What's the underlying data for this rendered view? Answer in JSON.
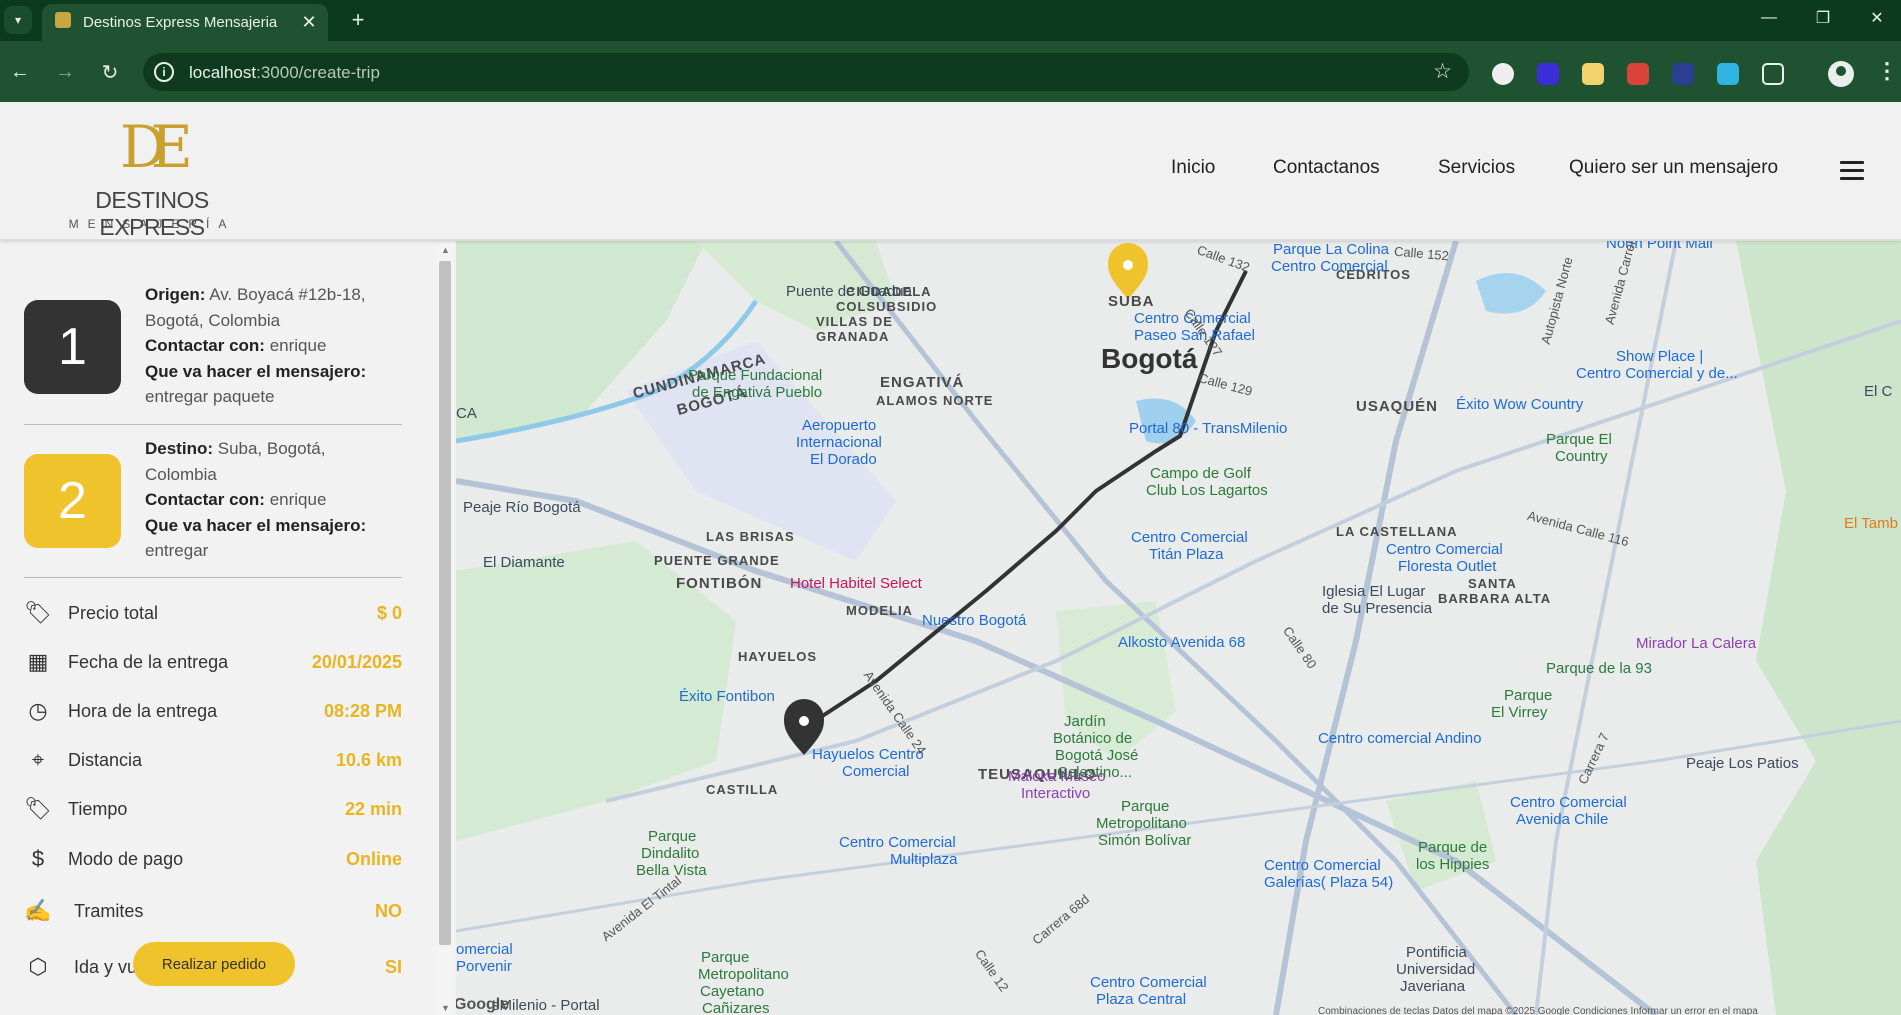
{
  "browser": {
    "tab_title": "Destinos Express Mensajeria",
    "url_host": "localhost",
    "url_path": ":3000/create-trip"
  },
  "header": {
    "logo_mono": "DE",
    "logo_name": "DESTINOS EXPRESS",
    "logo_sub": "MENSAJERÍA",
    "nav": [
      "Inicio",
      "Contactanos",
      "Servicios",
      "Quiero ser un mensajero"
    ]
  },
  "trip": {
    "origin": {
      "number": "1",
      "label": "Origen:",
      "address_line1": "Av. Boyacá #12b-18,",
      "address_line2": "Bogotá, Colombia",
      "contact_label": "Contactar con:",
      "contact": "enrique",
      "task_label": "Que va hacer el mensajero:",
      "task": "entregar paquete"
    },
    "destination": {
      "number": "2",
      "label": "Destino:",
      "address_line1": "Suba, Bogotá,",
      "address_line2": "Colombia",
      "contact_label": "Contactar con:",
      "contact": "enrique",
      "task_label": "Que va hacer el mensajero:",
      "task": "entregar"
    }
  },
  "summary": [
    {
      "label": "Precio total",
      "value": "$ 0",
      "icon": "price-tag-icon"
    },
    {
      "label": "Fecha de la entrega",
      "value": "20/01/2025",
      "icon": "calendar-icon"
    },
    {
      "label": "Hora de la entrega",
      "value": "08:28 PM",
      "icon": "clock-icon"
    },
    {
      "label": "Distancia",
      "value": "10.6 km",
      "icon": "location-pin-icon"
    },
    {
      "label": "Tiempo",
      "value": "22 min",
      "icon": "time-tag-icon"
    },
    {
      "label": "Modo de pago",
      "value": "Online",
      "icon": "dollar-icon"
    },
    {
      "label": "Tramites",
      "value": "NO",
      "icon": "document-sign-icon"
    },
    {
      "label": "Ida y vuelta",
      "value": "SI",
      "icon": "box-icon"
    }
  ],
  "order_button": "Realizar pedido",
  "colors": {
    "accent": "#efc32b",
    "value": "#e8b520",
    "dark_badge": "#333333"
  },
  "map": {
    "labels": {
      "bogota": "Bogotá",
      "suba": "SUBA",
      "engativa": "ENGATIVÁ",
      "fontibon": "FONTIBÓN",
      "usaquen": "USAQUÉN",
      "teusaquillo": "TEUSAQUILLO",
      "castilla": "CASTILLA",
      "hayuelos": "HAYUELOS",
      "modelia": "MODELIA",
      "la_castellana": "LA CASTELLANA",
      "cedritos": "CEDRITOS",
      "alamos": "ALAMOS NORTE",
      "villas1": "VILLAS DE",
      "villas2": "GRANADA",
      "ciudadela1": "CIUDADELA",
      "ciudadela2": "COLSUBSIDIO",
      "las_brisas": "LAS BRISAS",
      "puente_grande": "PUENTE GRANDE",
      "cundinamarca": "CUNDINAMARCA",
      "bogota_small": "BOGOTÁ",
      "santa_barbara1": "SANTA",
      "santa_barbara2": "BARBARA ALTA",
      "el_diamante": "El Diamante",
      "peaje_rio": "Peaje Río Bogotá",
      "puente_guadua": "Puente de Guadua",
      "parque_fundacional1": "Parque Fundacional",
      "parque_fundacional2": "de Engativá Pueblo",
      "aeropuerto1": "Aeropuerto",
      "aeropuerto2": "Internacional",
      "aeropuerto3": "El Dorado",
      "hotel": "Hotel Habitel Select",
      "nuestro_bogota": "Nuestro Bogotá",
      "exito_fontibon": "Éxito Fontibon",
      "hayuelos_cc1": "Hayuelos Centro",
      "hayuelos_cc2": "Comercial",
      "maloka1": "Maloka Museo",
      "maloka2": "Interactivo",
      "jardin1": "Jardín",
      "jardin2": "Botánico de",
      "jardin3": "Bogotá José",
      "jardin4": "Celestino...",
      "parque_simon1": "Parque",
      "parque_simon2": "Metropolitano",
      "parque_simon3": "Simón Bolívar",
      "alkosto": "Alkosto Avenida 68",
      "titan1": "Centro Comercial",
      "titan2": "Titán Plaza",
      "portal80": "Portal 80 - TransMilenio",
      "golf1": "Campo de Golf",
      "golf2": "Club Los Lagartos",
      "colina1": "Parque La Colina",
      "colina2": "Centro Comercial",
      "pasaje1": "Centro Comercial",
      "pasaje2": "Paseo San Rafael",
      "floresta1": "Centro Comercial",
      "floresta2": "Floresta Outlet",
      "iglesia1": "Iglesia El Lugar",
      "iglesia2": "de Su Presencia",
      "exito_country": "Éxito Wow Country",
      "parque_country1": "Parque El",
      "parque_country2": "Country",
      "north_point": "North Point Mall",
      "show_place1": "Show Place |",
      "show_place2": "Centro Comercial y de...",
      "mirador": "Mirador La Calera",
      "parque93": "Parque de la 93",
      "virrey1": "Parque",
      "virrey2": "El Virrey",
      "andino": "Centro comercial Andino",
      "peaje_patios": "Peaje Los Patios",
      "cc_chile1": "Centro Comercial",
      "cc_chile2": "Avenida Chile",
      "hippies1": "Parque de",
      "hippies2": "los Hippies",
      "galerias1": "Centro Comercial",
      "galerias2": "Galerías( Plaza 54)",
      "multiplaza1": "Centro Comercial",
      "multiplaza2": "Multiplaza",
      "dindalito1": "Parque",
      "dindalito2": "Dindalito",
      "dindalito3": "Bella Vista",
      "pontificia1": "Pontificia",
      "pontificia2": "Universidad",
      "pontificia3": "Javeriana",
      "parque_cayetano1": "Parque",
      "parque_cayetano2": "Metropolitano",
      "parque_cayetano3": "Cayetano",
      "parque_cayetano4": "Cañizares",
      "cc_porvenir1": "omercial",
      "cc_porvenir2": "Porvenir",
      "plaza_central1": "Centro Comercial",
      "plaza_central2": "Plaza Central",
      "portal_sm": "sMilenio - Portal",
      "el_tamb": "El Tamb",
      "el_c": "El C",
      "ca": "CA",
      "calle132": "Calle 132",
      "calle152": "Calle 152",
      "calle127": "Calle 127",
      "calle129": "Calle 129",
      "calle116": "Avenida Calle 116",
      "calle80": "Calle 80",
      "calle24": "Avenida Calle 24",
      "carrera68": "Carrera 68d",
      "calle12": "Calle 12",
      "tintal": "Avenida El Tintal",
      "autopista": "Autopista Norte",
      "carrera7": "Carrera 7",
      "av_carrera": "Avenida Carrera",
      "footer": "Combinaciones de teclas   Datos del mapa ©2025 Google   Condiciones   Informar un error en el mapa",
      "google": "Google"
    }
  }
}
